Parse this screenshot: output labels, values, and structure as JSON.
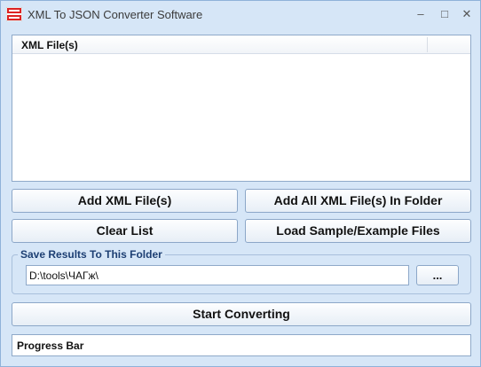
{
  "window": {
    "title": "XML To JSON Converter Software",
    "app_icon": "xml-json-app-icon",
    "controls": {
      "minimize": "–",
      "maximize": "□",
      "close": "✕"
    }
  },
  "file_list": {
    "column_header": "XML File(s)",
    "items": []
  },
  "buttons": {
    "add_files": "Add XML File(s)",
    "add_all_folder": "Add All XML File(s) In Folder",
    "clear_list": "Clear List",
    "load_samples": "Load Sample/Example Files",
    "browse": "...",
    "start": "Start Converting"
  },
  "output": {
    "group_label": "Save Results To This Folder",
    "folder_value": "D:\\tools\\ЧАГж\\"
  },
  "progress": {
    "label": "Progress Bar",
    "value": 0
  },
  "colors": {
    "window_bg": "#d6e6f7",
    "border": "#8fa9c9",
    "legend_text": "#1d3f73"
  }
}
